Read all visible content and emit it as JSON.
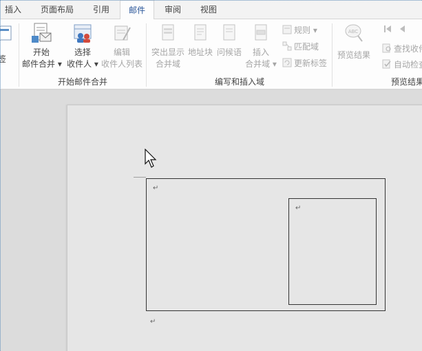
{
  "tabs": [
    {
      "label": "插入",
      "active": false
    },
    {
      "label": "页面布局",
      "active": false
    },
    {
      "label": "引用",
      "active": false
    },
    {
      "label": "邮件",
      "active": true
    },
    {
      "label": "审阅",
      "active": false
    },
    {
      "label": "视图",
      "active": false
    }
  ],
  "ribbon": {
    "partial_left_label": "签",
    "start_group": {
      "label": "开始邮件合并",
      "start_merge": {
        "line1": "开始",
        "line2": "邮件合并 ▾",
        "icon": "document-mail-icon"
      },
      "select_recipients": {
        "line1": "选择",
        "line2": "收件人 ▾",
        "icon": "recipients-icon"
      },
      "edit_recipients": {
        "line1": "编辑",
        "line2": "收件人列表",
        "icon": "edit-list-icon",
        "disabled": true
      }
    },
    "write_group": {
      "label": "编写和插入域",
      "highlight_fields": {
        "line1": "突出显示",
        "line2": "合并域",
        "disabled": true
      },
      "address_block": {
        "line1": "地址块",
        "disabled": true
      },
      "greeting_line": {
        "line1": "问候语",
        "disabled": true
      },
      "insert_field": {
        "line1": "插入",
        "line2": "合并域 ▾",
        "disabled": true
      },
      "rules": "规则 ▾",
      "match_fields": "匹配域",
      "update_labels": "更新标签"
    },
    "preview_group": {
      "label": "预览结果",
      "preview_results": "预览结果",
      "find_recipient": "查找收件",
      "auto_check": "自动检查"
    }
  },
  "document": {
    "paragraph_mark": "↵"
  }
}
